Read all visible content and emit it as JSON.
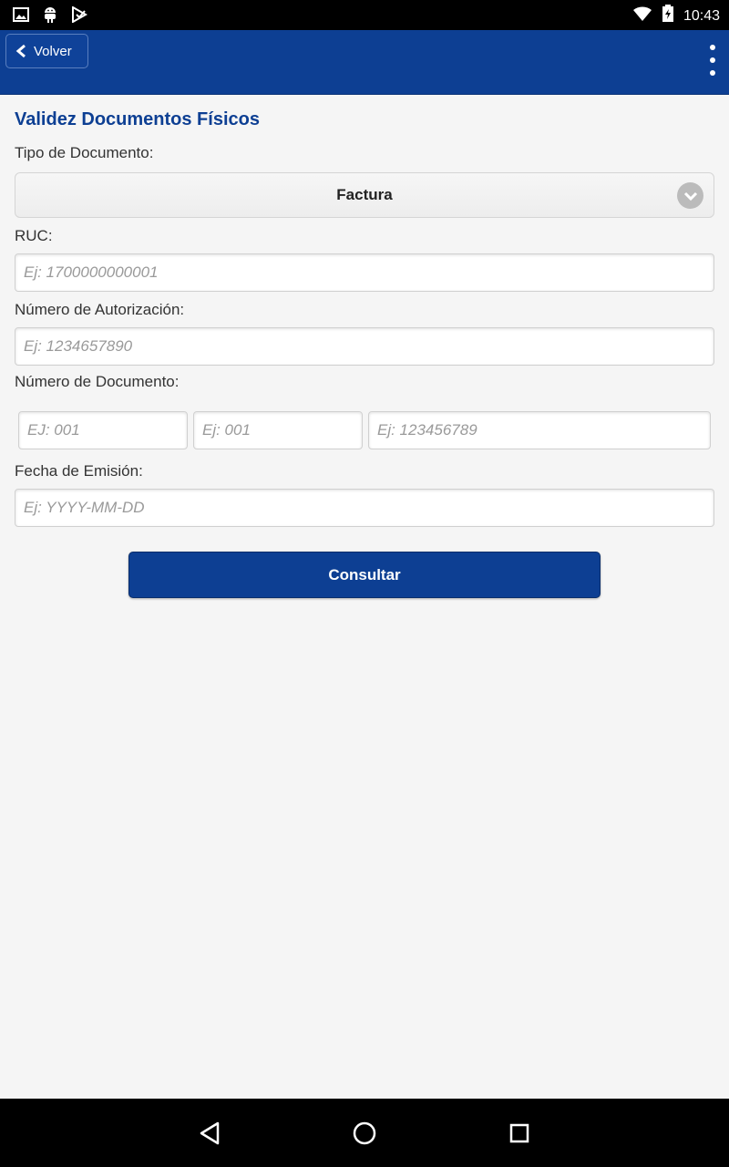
{
  "status_bar": {
    "time": "10:43",
    "left_icons": [
      "image-icon",
      "android-icon",
      "play-store-icon"
    ],
    "right_icons": [
      "wifi-icon",
      "battery-charging-icon"
    ]
  },
  "app_bar": {
    "back_label": "Volver",
    "menu_icon": "overflow-menu-icon",
    "color": "#0d3f93"
  },
  "form": {
    "title": "Validez Documentos Físicos",
    "tipo_label": "Tipo de Documento:",
    "tipo_value": "Factura",
    "ruc_label": "RUC:",
    "ruc_placeholder": "Ej: 1700000000001",
    "autorizacion_label": "Número de Autorización:",
    "autorizacion_placeholder": "Ej: 1234657890",
    "documento_label": "Número de Documento:",
    "documento_parts_placeholders": [
      "EJ: 001",
      "Ej: 001",
      "Ej: 123456789"
    ],
    "fecha_label": "Fecha de Emisión:",
    "fecha_placeholder": "Ej: YYYY-MM-DD",
    "submit_label": "Consultar"
  },
  "nav_bar": {
    "buttons": [
      "back-triangle-icon",
      "home-circle-icon",
      "recents-square-icon"
    ]
  }
}
